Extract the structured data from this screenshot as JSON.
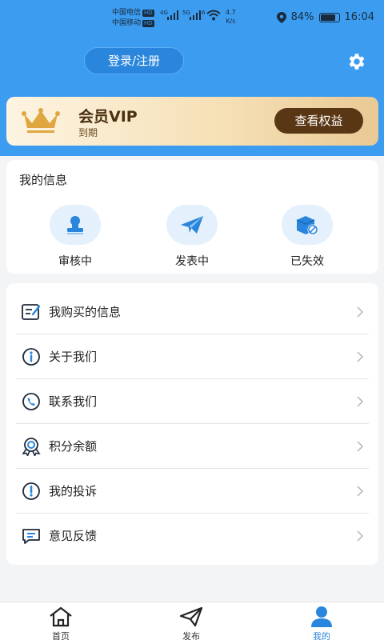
{
  "status_bar": {
    "carrier1": "中国电信",
    "carrier2": "中国移动",
    "hd": "HD",
    "net1": "4G",
    "net2": "5G",
    "net3": "6",
    "speed_value": "4.7",
    "speed_unit": "K/s",
    "battery": "84%",
    "battery_level": 0.84,
    "time": "16:04"
  },
  "header": {
    "login_label": "登录/注册",
    "settings_icon": "gear-icon",
    "color": "#3b9cf0"
  },
  "vip": {
    "title": "会员VIP",
    "status": "到期",
    "button": "查看权益",
    "icon": "crown-icon"
  },
  "my_info": {
    "title": "我的信息",
    "items": [
      {
        "label": "审核中",
        "icon": "reviewer-stamp-icon"
      },
      {
        "label": "发表中",
        "icon": "paper-plane-icon"
      },
      {
        "label": "已失效",
        "icon": "invalid-box-icon"
      }
    ]
  },
  "menu": {
    "items": [
      {
        "label": "我购买的信息",
        "icon": "purchase-list-icon"
      },
      {
        "label": "关于我们",
        "icon": "info-icon"
      },
      {
        "label": "联系我们",
        "icon": "phone-icon"
      },
      {
        "label": "积分余额",
        "icon": "badge-icon"
      },
      {
        "label": "我的投诉",
        "icon": "alert-icon"
      },
      {
        "label": "意见反馈",
        "icon": "feedback-icon"
      }
    ]
  },
  "tabbar": {
    "items": [
      {
        "label": "首页",
        "icon": "home-icon",
        "active": false
      },
      {
        "label": "发布",
        "icon": "send-icon",
        "active": false
      },
      {
        "label": "我的",
        "icon": "user-icon",
        "active": true
      }
    ]
  }
}
